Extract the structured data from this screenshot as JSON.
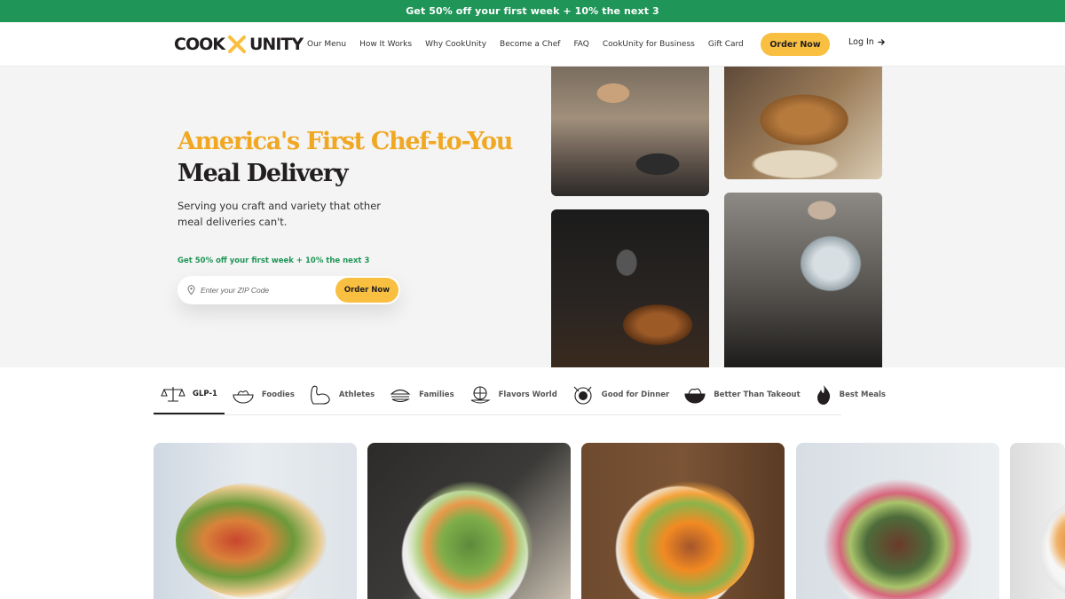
{
  "promo_bar": {
    "text": "Get 50% off your first week + 10% the next 3"
  },
  "header": {
    "logo": {
      "left": "COOK",
      "right": "UNITY"
    },
    "nav": [
      "Our Menu",
      "How It Works",
      "Why CookUnity",
      "Become a Chef",
      "FAQ",
      "CookUnity for Business",
      "Gift Card"
    ],
    "order_button": "Order Now",
    "login": "Log In",
    "accent_color": "#f8bf40"
  },
  "hero": {
    "title_line1": "America's First Chef-to-You",
    "title_line2": "Meal Delivery",
    "subtitle": "Serving you craft and variety that other meal deliveries can't.",
    "offer": "Get 50% off your first week + 10% the next 3",
    "zip_placeholder": "Enter your ZIP Code",
    "zip_button": "Order Now",
    "title_color": "#f0a823",
    "offer_color": "#1f9557"
  },
  "categories": [
    {
      "label": "GLP-1",
      "icon": "scale-icon",
      "active": true
    },
    {
      "label": "Foodies",
      "icon": "bowl-icon",
      "active": false
    },
    {
      "label": "Athletes",
      "icon": "flexed-arm-icon",
      "active": false
    },
    {
      "label": "Families",
      "icon": "sandwich-icon",
      "active": false
    },
    {
      "label": "Flavors World",
      "icon": "globe-dish-icon",
      "active": false
    },
    {
      "label": "Good for Dinner",
      "icon": "dinner-plate-icon",
      "active": false
    },
    {
      "label": "Better Than Takeout",
      "icon": "takeout-bowl-icon",
      "active": false
    },
    {
      "label": "Best Meals",
      "icon": "flame-icon",
      "active": false
    }
  ]
}
